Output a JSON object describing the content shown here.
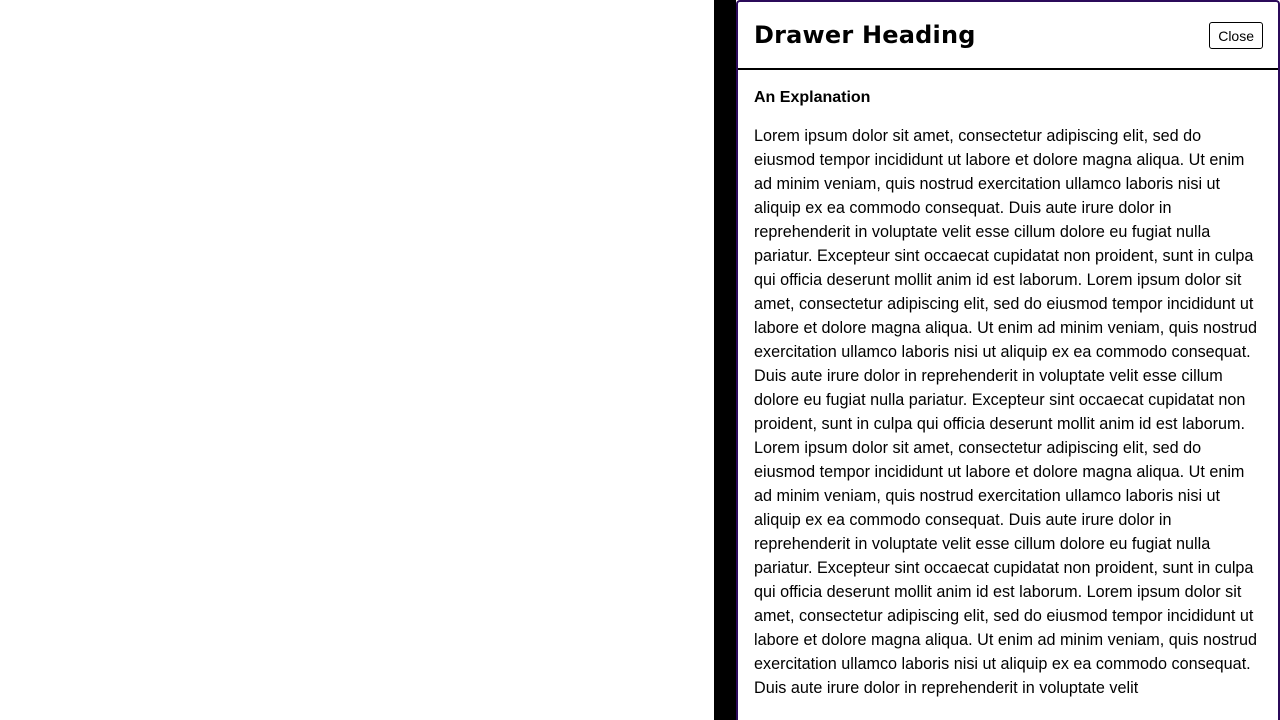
{
  "drawer": {
    "title": "Drawer Heading",
    "close_label": "Close",
    "section_heading": "An Explanation",
    "body_text": "Lorem ipsum dolor sit amet, consectetur adipiscing elit, sed do eiusmod tempor incididunt ut labore et dolore magna aliqua. Ut enim ad minim veniam, quis nostrud exercitation ullamco laboris nisi ut aliquip ex ea commodo consequat. Duis aute irure dolor in reprehenderit in voluptate velit esse cillum dolore eu fugiat nulla pariatur. Excepteur sint occaecat cupidatat non proident, sunt in culpa qui officia deserunt mollit anim id est laborum. Lorem ipsum dolor sit amet, consectetur adipiscing elit, sed do eiusmod tempor incididunt ut labore et dolore magna aliqua. Ut enim ad minim veniam, quis nostrud exercitation ullamco laboris nisi ut aliquip ex ea commodo consequat. Duis aute irure dolor in reprehenderit in voluptate velit esse cillum dolore eu fugiat nulla pariatur. Excepteur sint occaecat cupidatat non proident, sunt in culpa qui officia deserunt mollit anim id est laborum. Lorem ipsum dolor sit amet, consectetur adipiscing elit, sed do eiusmod tempor incididunt ut labore et dolore magna aliqua. Ut enim ad minim veniam, quis nostrud exercitation ullamco laboris nisi ut aliquip ex ea commodo consequat. Duis aute irure dolor in reprehenderit in voluptate velit esse cillum dolore eu fugiat nulla pariatur. Excepteur sint occaecat cupidatat non proident, sunt in culpa qui officia deserunt mollit anim id est laborum. Lorem ipsum dolor sit amet, consectetur adipiscing elit, sed do eiusmod tempor incididunt ut labore et dolore magna aliqua. Ut enim ad minim veniam, quis nostrud exercitation ullamco laboris nisi ut aliquip ex ea commodo consequat. Duis aute irure dolor in reprehenderit in voluptate velit"
  },
  "colors": {
    "drawer_border": "#2b0a5a",
    "backdrop_strip": "#000000",
    "page_background": "#ffffff"
  }
}
